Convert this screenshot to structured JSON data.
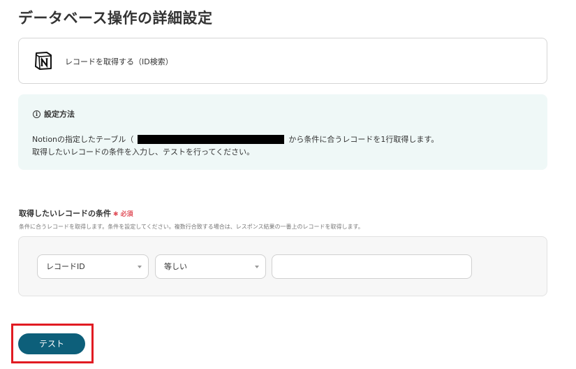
{
  "page": {
    "title": "データベース操作の詳細設定"
  },
  "action": {
    "label": "レコードを取得する（ID検索）",
    "icon": "notion-logo"
  },
  "info": {
    "title": "設定方法",
    "icon": "info-icon",
    "line1_before": "Notionの指定したテーブル（",
    "line1_after": "から条件に合うレコードを1行取得します。",
    "line2": "取得したいレコードの条件を入力し、テストを行ってください。"
  },
  "condition": {
    "label": "取得したいレコードの条件",
    "required": "✱ 必須",
    "help": "条件に合うレコードを取得します。条件を設定してください。複数行合致する場合は、レスポンス結果の一番上のレコードを取得します。",
    "field_select": "レコードID",
    "operator_select": "等しい",
    "value": ""
  },
  "test_button": {
    "label": "テスト"
  },
  "colors": {
    "accent": "#0d5f7a",
    "info_bg": "#eff8f7",
    "required": "#e0505a",
    "highlight": "#e11b22"
  }
}
